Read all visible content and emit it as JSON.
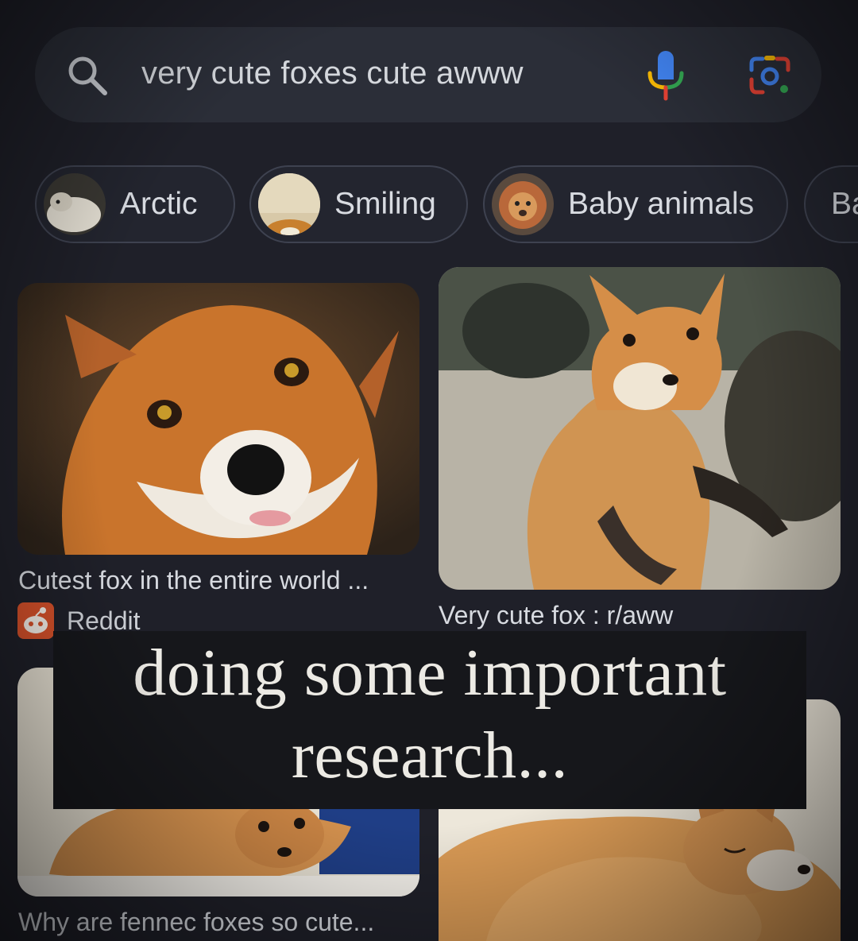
{
  "search": {
    "query": "very cute foxes cute awww",
    "icons": [
      "search-icon",
      "microphone-icon",
      "camera-lens-icon"
    ]
  },
  "chips": [
    {
      "label": "Arctic",
      "icon": "arctic-fox-thumbnail"
    },
    {
      "label": "Smiling",
      "icon": "smiling-fox-thumbnail"
    },
    {
      "label": "Baby animals",
      "icon": "baby-animals-thumbnail"
    },
    {
      "label": "Ba",
      "icon": ""
    }
  ],
  "results": [
    {
      "caption": "Cutest fox in the entire world ...",
      "source": "Reddit",
      "source_icon": "reddit-icon"
    },
    {
      "caption": "Very cute fox : r/aww"
    },
    {
      "caption": "Why are fennec foxes so cute..."
    },
    {
      "caption": ""
    }
  ],
  "overlay": {
    "line1": "doing some important",
    "line2": "research..."
  },
  "colors": {
    "background": "#1f2029",
    "searchbar": "#2b2e38",
    "chip_border": "#3e4250",
    "overlay_bg": "#16171b",
    "fox_orange": "#d9822f",
    "google_blue": "#4285f4",
    "google_red": "#ea4335",
    "google_yellow": "#fbbc05",
    "google_green": "#34a853"
  }
}
